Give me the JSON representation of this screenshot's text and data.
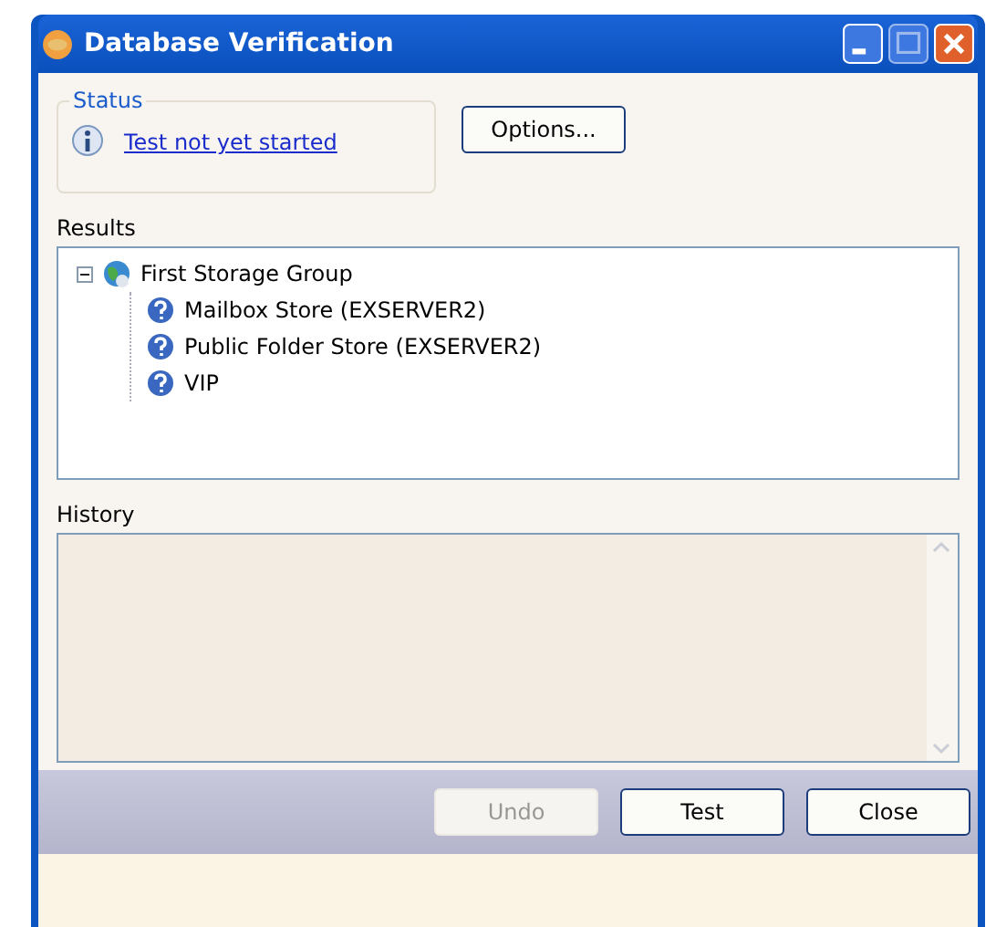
{
  "window": {
    "title": "Database Verification"
  },
  "status": {
    "label": "Status",
    "message": "Test not yet started"
  },
  "options_button": "Options...",
  "results": {
    "label": "Results",
    "tree": [
      {
        "label": "First Storage Group",
        "kind": "group",
        "expanded": true,
        "children": [
          {
            "label": "Mailbox Store (EXSERVER2)",
            "kind": "store"
          },
          {
            "label": "Public Folder Store (EXSERVER2)",
            "kind": "store"
          },
          {
            "label": "VIP",
            "kind": "store"
          }
        ]
      }
    ]
  },
  "history": {
    "label": "History"
  },
  "buttons": [
    {
      "label": "Undo",
      "disabled": true
    },
    {
      "label": "Test",
      "disabled": false
    },
    {
      "label": "Close",
      "disabled": false
    }
  ]
}
